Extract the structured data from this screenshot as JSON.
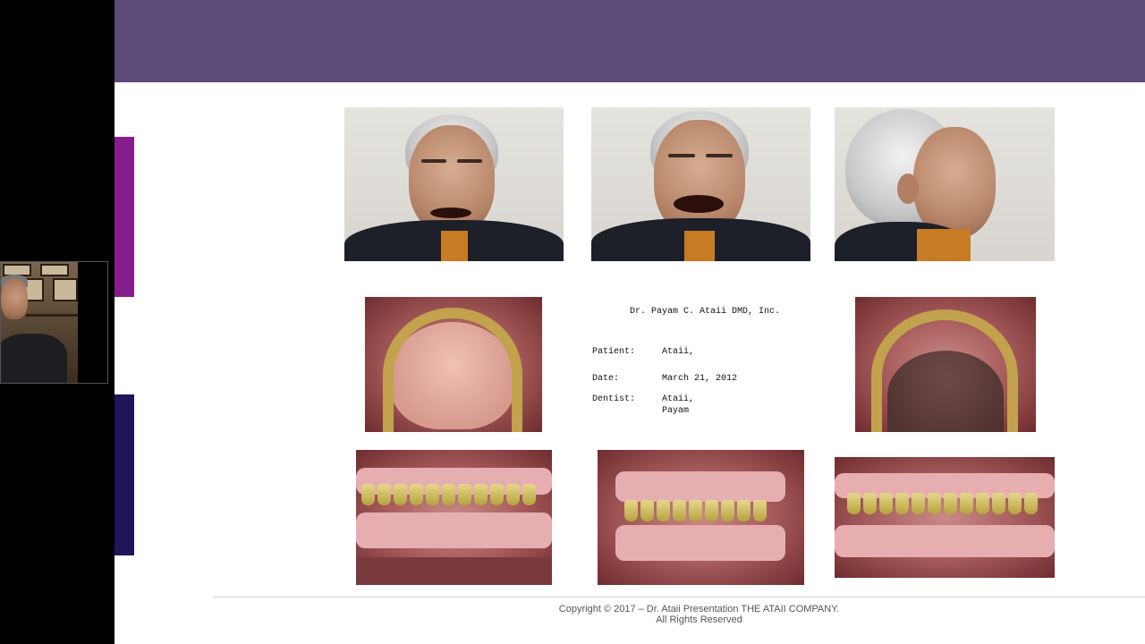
{
  "webcam": {
    "participant": "presenter"
  },
  "slide": {
    "header_color": "#5c4a7a",
    "accent_colors": [
      "#861d8e",
      "#1f165a"
    ],
    "record": {
      "title": "Dr. Payam C. Ataii DMD, Inc.",
      "patient_label": "Patient:",
      "patient_value": "Ataii,",
      "date_label": "Date:",
      "date_value": "March 21, 2012",
      "dentist_label": "Dentist:",
      "dentist_value_line1": "Ataii,",
      "dentist_value_line2": "Payam"
    },
    "footer": {
      "line1": "Copyright © 2017 – Dr. Ataii Presentation THE ATAII COMPANY.",
      "line2": "All Rights Reserved"
    }
  }
}
